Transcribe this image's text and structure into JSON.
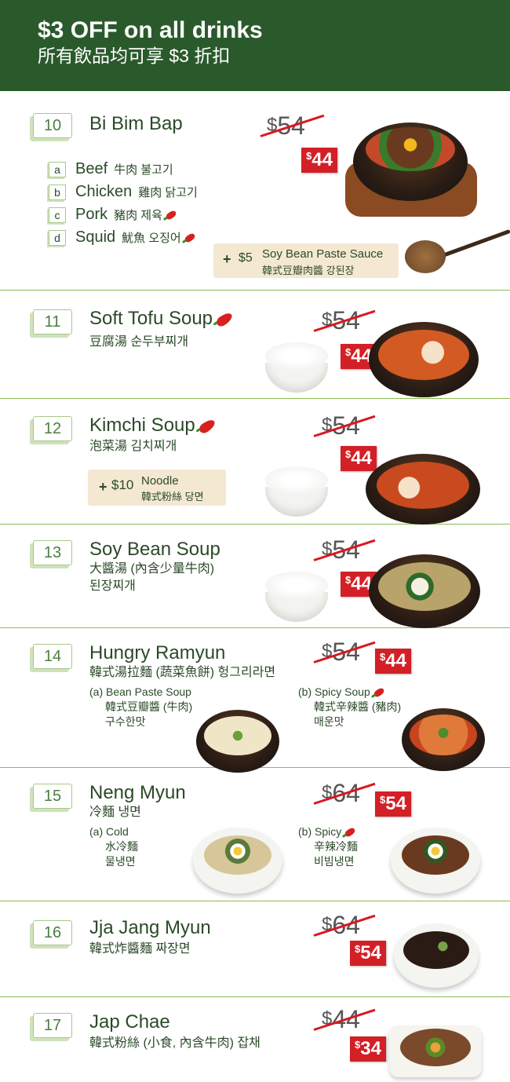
{
  "banner": {
    "line1": "$3 OFF on all drinks",
    "line2": "所有飲品均可享 $3 折扣"
  },
  "colors": {
    "banner_green": "#2a5a2c",
    "accent_red": "#d31f26",
    "divider_green": "#8bbd52"
  },
  "items": [
    {
      "number": "10",
      "title": "Bi Bim Bap",
      "old_price": "54",
      "new_price": "44",
      "options": [
        {
          "letter": "a",
          "en": "Beef",
          "cn": "牛肉 불고기",
          "spicy": false
        },
        {
          "letter": "b",
          "en": "Chicken",
          "cn": "雞肉 닭고기",
          "spicy": false
        },
        {
          "letter": "c",
          "en": "Pork",
          "cn": "豬肉 제육",
          "spicy": true
        },
        {
          "letter": "d",
          "en": "Squid",
          "cn": "魷魚 오징어",
          "spicy": true
        }
      ],
      "addon": {
        "plus": "+",
        "price": "$5",
        "en": "Soy Bean Paste Sauce",
        "cn": "韓式豆瓣肉醬 강된장"
      },
      "image": "bibimbap-stone-bowl-icon"
    },
    {
      "number": "11",
      "title": "Soft Tofu Soup",
      "spicy": true,
      "subtitle": "豆腐湯 순두부찌개",
      "old_price": "54",
      "new_price": "44",
      "image": "tofu-soup-icon"
    },
    {
      "number": "12",
      "title": "Kimchi Soup",
      "spicy": true,
      "subtitle": "泡菜湯 김치찌개",
      "old_price": "54",
      "new_price": "44",
      "addon": {
        "plus": "+",
        "price": "$10",
        "en": "Noodle",
        "cn": "韓式粉絲 당면"
      },
      "image": "kimchi-soup-icon"
    },
    {
      "number": "13",
      "title": "Soy Bean Soup",
      "subtitle": "大醬湯 (內含少量牛肉)",
      "subtitle2": "된장찌개",
      "old_price": "54",
      "new_price": "44",
      "image": "soy-bean-soup-icon"
    },
    {
      "number": "14",
      "title": "Hungry Ramyun",
      "subtitle": "韓式湯拉麵 (蔬菜魚餅) 헝그리라면",
      "old_price": "54",
      "new_price": "44",
      "variant_a": {
        "label": "(a) Bean Paste Soup",
        "cn": "韓式豆瓣醬 (牛肉)",
        "kr": "구수한맛"
      },
      "variant_b": {
        "label": "(b) Spicy Soup",
        "cn": "韓式辛辣醬 (豬肉)",
        "kr": "매운맛"
      }
    },
    {
      "number": "15",
      "title": "Neng Myun",
      "subtitle": "冷麵 냉면",
      "old_price": "64",
      "new_price": "54",
      "variant_a": {
        "label": "(a) Cold",
        "cn": "水冷麵",
        "kr": "물냉면"
      },
      "variant_b": {
        "label": "(b) Spicy",
        "cn": "辛辣冷麵",
        "kr": "비빔냉면"
      }
    },
    {
      "number": "16",
      "title": "Jja Jang Myun",
      "subtitle": "韓式炸醬麵 짜장면",
      "old_price": "64",
      "new_price": "54"
    },
    {
      "number": "17",
      "title": "Jap Chae",
      "subtitle": "韓式粉絲 (小食, 內含牛肉) 잡채",
      "old_price": "44",
      "new_price": "34"
    }
  ]
}
